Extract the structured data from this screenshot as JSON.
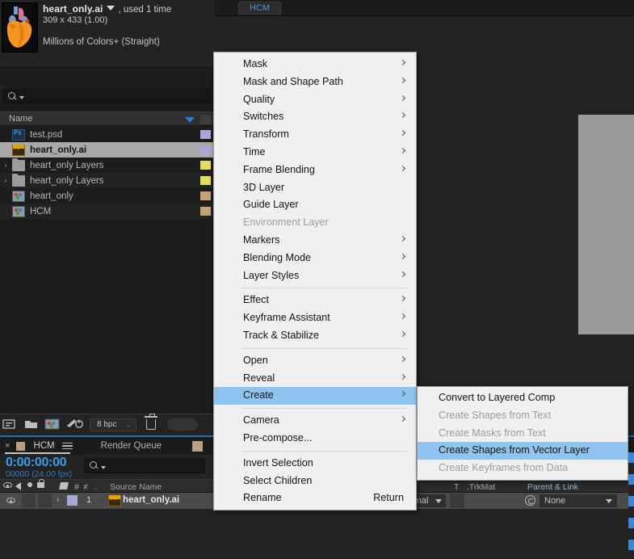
{
  "project": {
    "title": "heart_only.ai",
    "used": ", used 1 time",
    "dimensions": "309 x 433 (1.00)",
    "color_depth": "Millions of Colors+ (Straight)",
    "search_placeholder": "",
    "column_header": "Name",
    "items": [
      {
        "name": "test.psd",
        "icon": "photoshop-file-icon",
        "label_color": "#a9a8d4",
        "selected": false,
        "disclosure": ""
      },
      {
        "name": "heart_only.ai",
        "icon": "illustrator-file-icon",
        "label_color": "#a9a8d4",
        "selected": true,
        "disclosure": ""
      },
      {
        "name": "heart_only Layers",
        "icon": "folder-icon",
        "label_color": "#e0df62",
        "selected": false,
        "disclosure": "›"
      },
      {
        "name": "heart_only Layers",
        "icon": "folder-icon",
        "label_color": "#e0df62",
        "selected": false,
        "disclosure": "›"
      },
      {
        "name": "heart_only",
        "icon": "composition-icon",
        "label_color": "#c2a478",
        "selected": false,
        "disclosure": ""
      },
      {
        "name": "HCM",
        "icon": "composition-icon",
        "label_color": "#c2a478",
        "selected": false,
        "disclosure": ""
      }
    ],
    "toolbar": {
      "bit_depth": "8 bpc",
      "bit_depth_suffix": "."
    }
  },
  "viewer": {
    "tab_label": "HCM"
  },
  "timeline": {
    "close_label": "×",
    "comp_name": "HCM",
    "render_queue_label": "Render Queue",
    "current_time": "0:00:00:00",
    "frame_info": "00000 (24.00 fps)",
    "search_placeholder": "",
    "columns": {
      "source_name": "Source Name",
      "t": "T",
      "trkmat": ".TrkMat",
      "parent_link": "Parent & Link",
      "hash": "#",
      "mode_marker": "≠",
      "dot": "."
    },
    "row": {
      "index": "1",
      "layer_name": "heart_only.ai",
      "disclosure": "›",
      "blend_mode": "Normal",
      "parent": "None"
    }
  },
  "context_menu": {
    "items": [
      {
        "label": "Mask",
        "submenu": true,
        "disabled": false,
        "highlighted": false,
        "separator_after": false
      },
      {
        "label": "Mask and Shape Path",
        "submenu": true,
        "disabled": false,
        "highlighted": false,
        "separator_after": false
      },
      {
        "label": "Quality",
        "submenu": true,
        "disabled": false,
        "highlighted": false,
        "separator_after": false
      },
      {
        "label": "Switches",
        "submenu": true,
        "disabled": false,
        "highlighted": false,
        "separator_after": false
      },
      {
        "label": "Transform",
        "submenu": true,
        "disabled": false,
        "highlighted": false,
        "separator_after": false
      },
      {
        "label": "Time",
        "submenu": true,
        "disabled": false,
        "highlighted": false,
        "separator_after": false
      },
      {
        "label": "Frame Blending",
        "submenu": true,
        "disabled": false,
        "highlighted": false,
        "separator_after": false
      },
      {
        "label": "3D Layer",
        "submenu": false,
        "disabled": false,
        "highlighted": false,
        "separator_after": false
      },
      {
        "label": "Guide Layer",
        "submenu": false,
        "disabled": false,
        "highlighted": false,
        "separator_after": false
      },
      {
        "label": "Environment Layer",
        "submenu": false,
        "disabled": true,
        "highlighted": false,
        "separator_after": false
      },
      {
        "label": "Markers",
        "submenu": true,
        "disabled": false,
        "highlighted": false,
        "separator_after": false
      },
      {
        "label": "Blending Mode",
        "submenu": true,
        "disabled": false,
        "highlighted": false,
        "separator_after": false
      },
      {
        "label": "Layer Styles",
        "submenu": true,
        "disabled": false,
        "highlighted": false,
        "separator_after": true
      },
      {
        "label": "Effect",
        "submenu": true,
        "disabled": false,
        "highlighted": false,
        "separator_after": false
      },
      {
        "label": "Keyframe Assistant",
        "submenu": true,
        "disabled": false,
        "highlighted": false,
        "separator_after": false
      },
      {
        "label": "Track & Stabilize",
        "submenu": true,
        "disabled": false,
        "highlighted": false,
        "separator_after": true
      },
      {
        "label": "Open",
        "submenu": true,
        "disabled": false,
        "highlighted": false,
        "separator_after": false
      },
      {
        "label": "Reveal",
        "submenu": true,
        "disabled": false,
        "highlighted": false,
        "separator_after": false
      },
      {
        "label": "Create",
        "submenu": true,
        "disabled": false,
        "highlighted": true,
        "separator_after": true
      },
      {
        "label": "Camera",
        "submenu": true,
        "disabled": false,
        "highlighted": false,
        "separator_after": false
      },
      {
        "label": "Pre-compose...",
        "submenu": false,
        "disabled": false,
        "highlighted": false,
        "separator_after": true
      },
      {
        "label": "Invert Selection",
        "submenu": false,
        "disabled": false,
        "highlighted": false,
        "separator_after": false
      },
      {
        "label": "Select Children",
        "submenu": false,
        "disabled": false,
        "highlighted": false,
        "separator_after": false
      },
      {
        "label": "Rename",
        "submenu": false,
        "disabled": false,
        "highlighted": false,
        "separator_after": false,
        "shortcut": "Return"
      }
    ]
  },
  "submenu": {
    "items": [
      {
        "label": "Convert to Layered Comp",
        "disabled": false,
        "highlighted": false
      },
      {
        "label": "Create Shapes from Text",
        "disabled": true,
        "highlighted": false
      },
      {
        "label": "Create Masks from Text",
        "disabled": true,
        "highlighted": false
      },
      {
        "label": "Create Shapes from Vector Layer",
        "disabled": false,
        "highlighted": true
      },
      {
        "label": "Create Keyframes from Data",
        "disabled": true,
        "highlighted": false
      }
    ]
  },
  "colors": {
    "accent_blue": "#3b86d8",
    "menu_highlight": "#8fc4f0",
    "panel_bg": "#232323",
    "selection_gray": "#a9a9a9"
  }
}
